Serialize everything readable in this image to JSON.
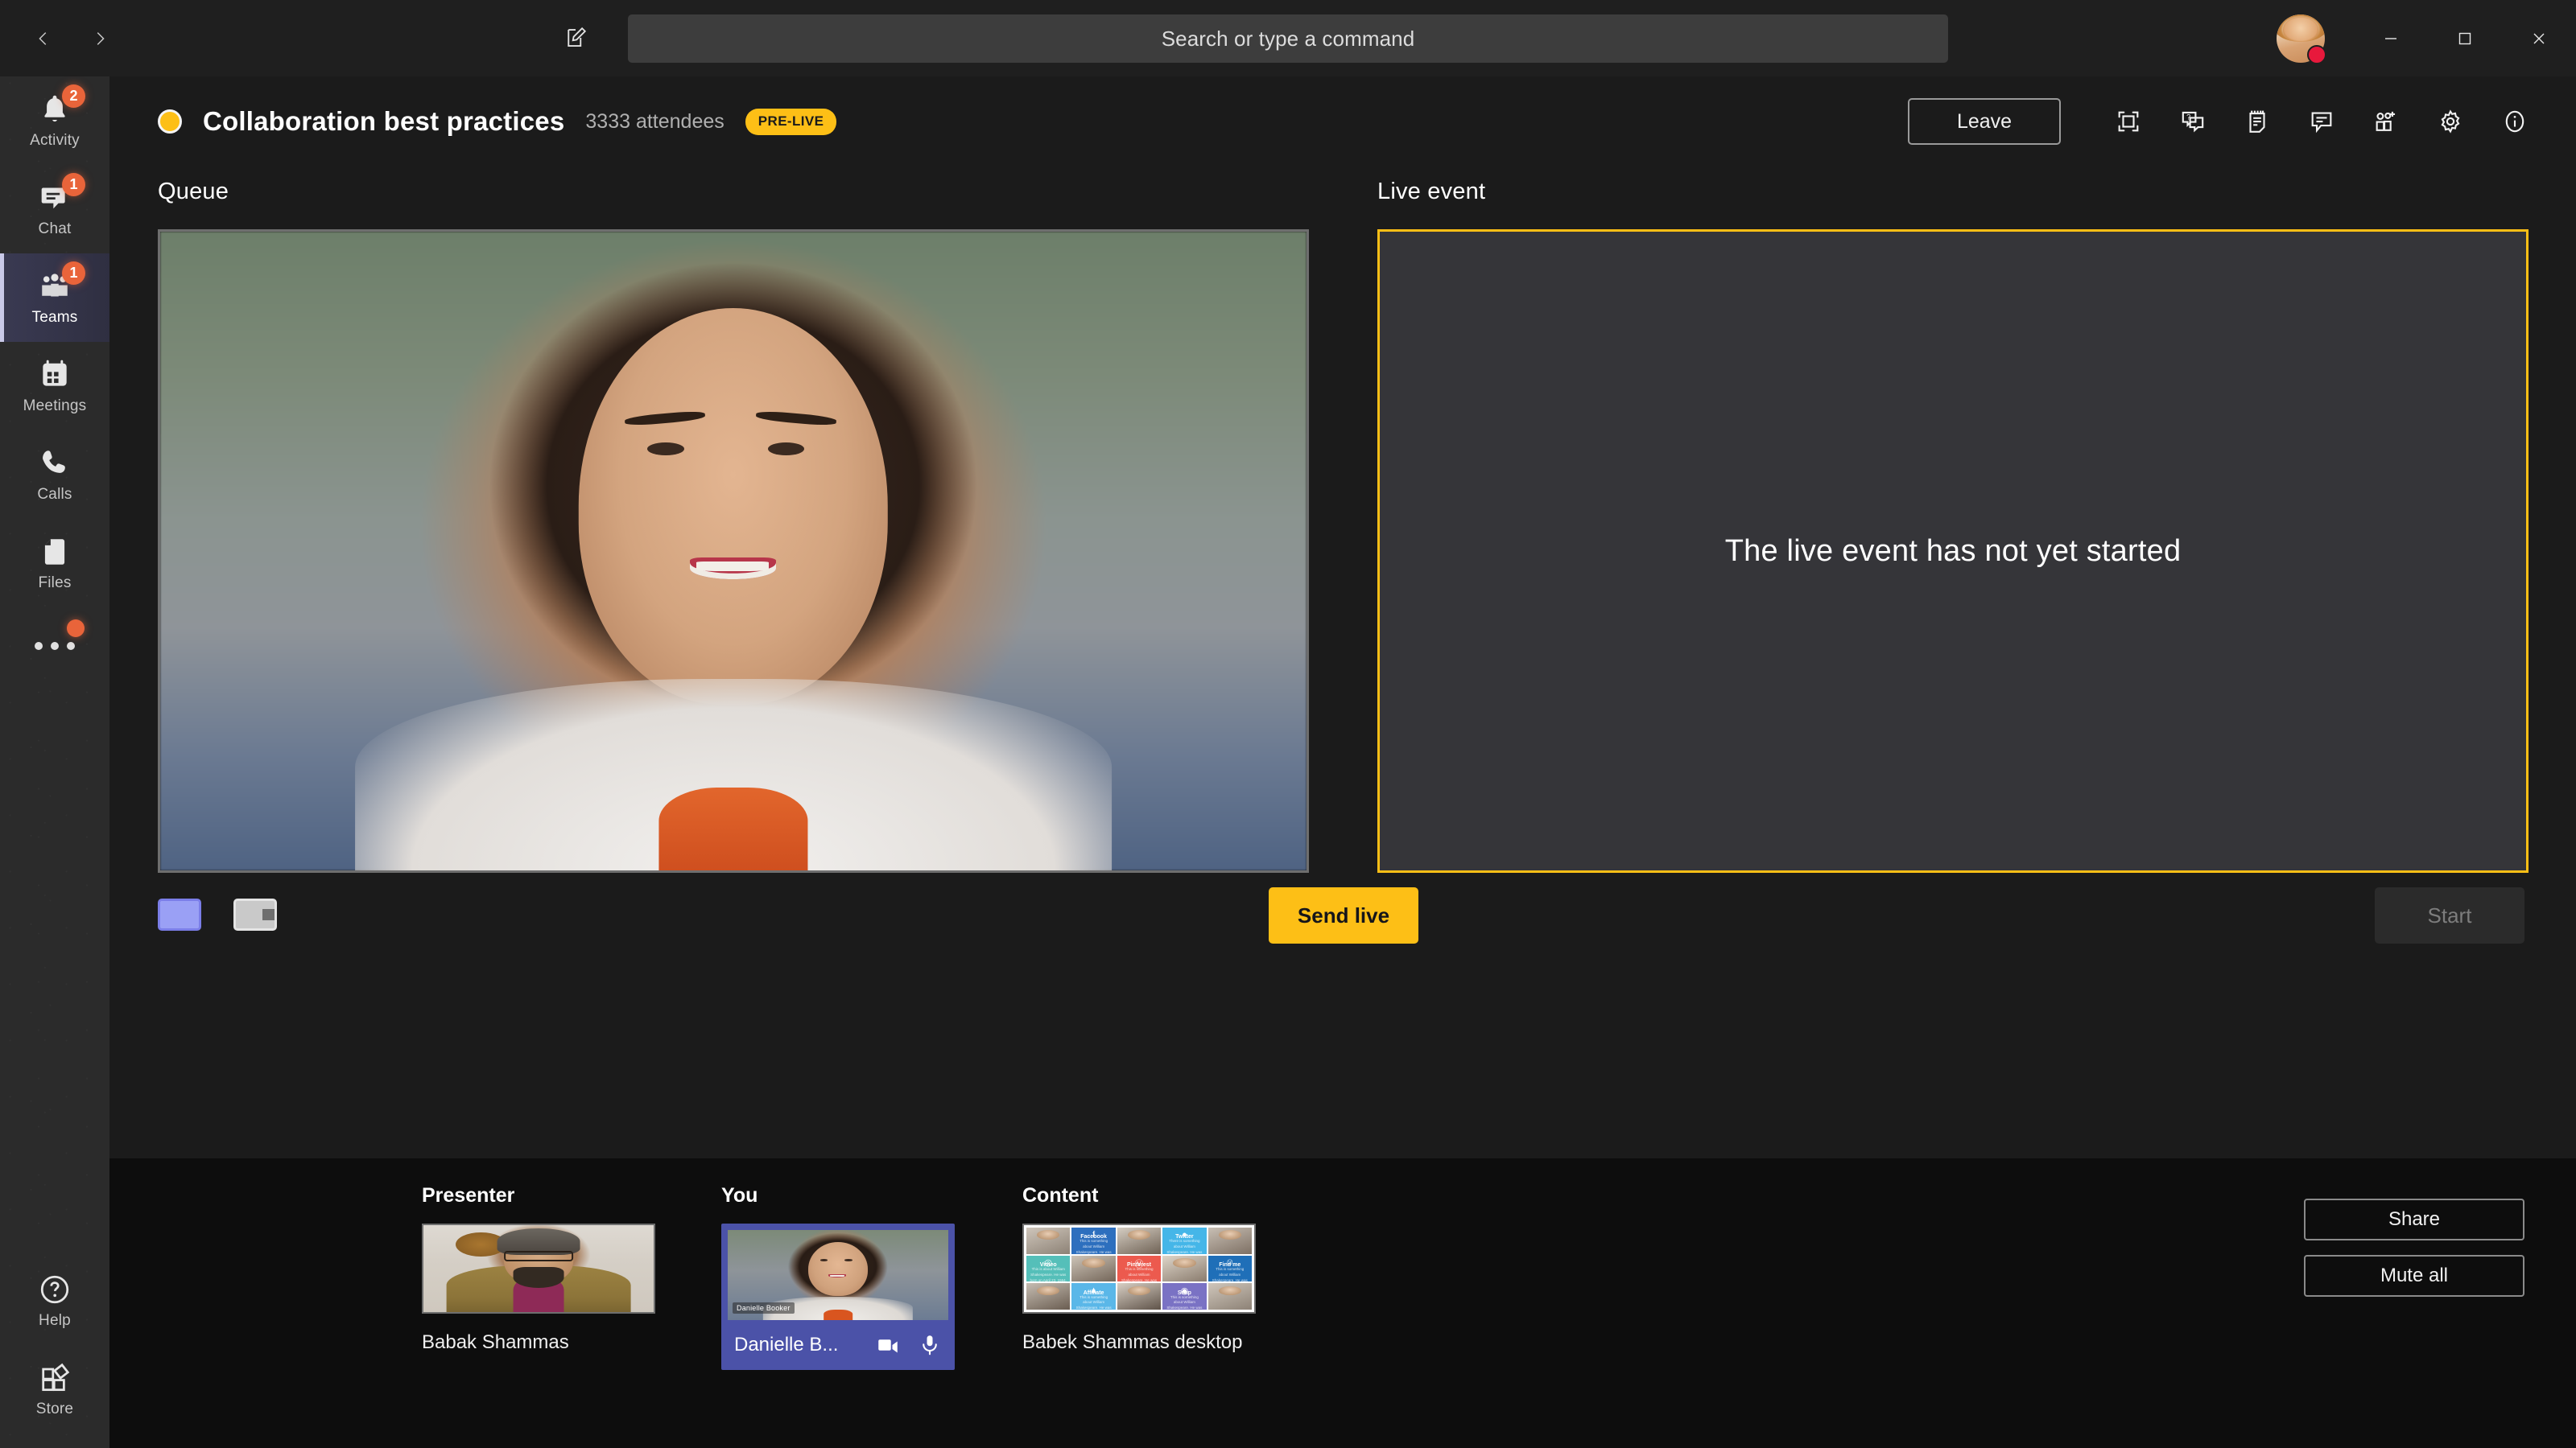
{
  "titlebar": {
    "back_icon": "chevron-left-icon",
    "forward_icon": "chevron-right-icon",
    "compose_icon": "compose-icon",
    "search_placeholder": "Search or type a command",
    "minimize_icon": "minimize-icon",
    "maximize_icon": "maximize-icon",
    "close_icon": "close-icon",
    "presence_color": "#e8193c"
  },
  "rail": {
    "items": [
      {
        "label": "Activity",
        "icon": "bell-icon",
        "badge": "2",
        "active": false
      },
      {
        "label": "Chat",
        "icon": "chat-icon",
        "badge": "1",
        "active": false
      },
      {
        "label": "Teams",
        "icon": "teams-icon",
        "badge": "1",
        "active": true
      },
      {
        "label": "Meetings",
        "icon": "calendar-icon",
        "badge": "",
        "active": false
      },
      {
        "label": "Calls",
        "icon": "phone-icon",
        "badge": "",
        "active": false
      },
      {
        "label": "Files",
        "icon": "file-icon",
        "badge": "",
        "active": false
      }
    ],
    "more_icon": "ellipsis-icon",
    "bottom": [
      {
        "label": "Help",
        "icon": "help-icon"
      },
      {
        "label": "Store",
        "icon": "store-icon"
      }
    ],
    "badge_color": "#e9643a",
    "active_accent": "#c9c9e8"
  },
  "meeting": {
    "status_dot": "live-status-dot",
    "title": "Collaboration best practices",
    "attendees": "3333 attendees",
    "state_badge": "PRE-LIVE",
    "state_badge_color": "#fdbf16",
    "leave_label": "Leave",
    "toolbar": [
      {
        "name": "fullscreen-icon",
        "title": "Full screen"
      },
      {
        "name": "qna-icon",
        "title": "Q&A"
      },
      {
        "name": "notes-icon",
        "title": "Meeting notes"
      },
      {
        "name": "chat-bubble-icon",
        "title": "Show conversation"
      },
      {
        "name": "add-participants-icon",
        "title": "Add participants"
      },
      {
        "name": "settings-gear-icon",
        "title": "Device settings"
      },
      {
        "name": "info-icon",
        "title": "Live event info"
      }
    ]
  },
  "stage": {
    "queue_label": "Queue",
    "live_label": "Live event",
    "live_message": "The live event has not yet started",
    "live_border_color": "#fdbf16",
    "layouts": [
      {
        "name": "layout-single",
        "selected": true
      },
      {
        "name": "layout-split",
        "selected": false
      }
    ],
    "send_live_label": "Send live",
    "send_live_color": "#fdbf16",
    "start_label": "Start",
    "start_disabled": true
  },
  "tray": {
    "columns": [
      {
        "caption": "Presenter",
        "name": "Babak Shammas",
        "selected": false
      },
      {
        "caption": "You",
        "name": "Danielle B...",
        "selected": true,
        "video_label": "Danielle Booker",
        "controls": [
          {
            "name": "camera-icon"
          },
          {
            "name": "microphone-icon"
          }
        ]
      },
      {
        "caption": "Content",
        "name": "Babek Shammas desktop",
        "selected": false
      }
    ],
    "selected_color": "#4b52a8",
    "buttons": [
      {
        "label": "Share",
        "name": "share-button"
      },
      {
        "label": "Mute all",
        "name": "mute-all-button"
      }
    ],
    "content_tiles": [
      {
        "kind": "photo"
      },
      {
        "kind": "brand",
        "label": "Facebook",
        "glyph": "f",
        "body": "This is something about William Shakespeare. He was born on April 23, 1564, in Stratford-upon-Avon. The rest of John Shakespeare."
      },
      {
        "kind": "photo"
      },
      {
        "kind": "brand",
        "label": "Twitter",
        "glyph": "ᵔ",
        "body": "There is something about William Shakespeare. He was born on April 23, 1564, in Stratford-upon-Avon. The rest of John Shakespeare."
      },
      {
        "kind": "photo"
      },
      {
        "kind": "brand",
        "label": "Vimeo",
        "glyph": "v",
        "body": "This is about William Shakespeare. He was born on April 23, 1564, in Stratford-upon-Avon. The rest of John Shakespeare."
      },
      {
        "kind": "photo"
      },
      {
        "kind": "brand",
        "label": "Pinterest",
        "glyph": "Ⓟ",
        "body": "This is something about William Shakespeare. He was born on April 23, 1564, in Stratford-upon-Avon. The rest of John Shakespeare."
      },
      {
        "kind": "photo"
      },
      {
        "kind": "brand",
        "label": "Find me",
        "glyph": "☺",
        "body": "This is something about William Shakespeare. He was born on April 23, 1564, in Stratford-upon-Avon. The rest of John Shakespeare."
      },
      {
        "kind": "photo"
      },
      {
        "kind": "brand",
        "label": "Affiliate",
        "glyph": "▲",
        "body": "This is something about William Shakespeare. He was born on April 23, 1564, in Stratford-upon-Avon. The rest of John Shakespeare."
      },
      {
        "kind": "photo"
      },
      {
        "kind": "brand",
        "label": "Snap",
        "glyph": "◉",
        "body": "This is something about William Shakespeare. He was born on April 23, 1564, in Stratford-upon-Avon. The rest of John Shakespeare."
      },
      {
        "kind": "photo"
      }
    ]
  }
}
